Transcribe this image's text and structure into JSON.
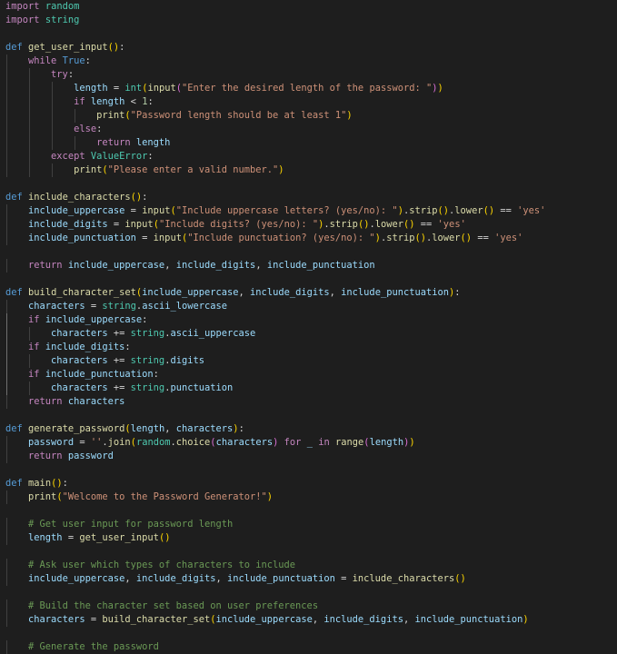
{
  "editor": {
    "language": "python",
    "theme_colors": {
      "background": "#1e1e1e",
      "keyword_control": "#c586c0",
      "keyword": "#569cd6",
      "function": "#dcdcaa",
      "variable": "#9cdcfe",
      "module": "#4ec9b0",
      "string": "#ce9178",
      "number": "#b5cea8",
      "comment": "#6a9955",
      "plain": "#d4d4d4",
      "bracket_1": "#ffd700",
      "bracket_2": "#da70d6",
      "bracket_3": "#179fff"
    },
    "lines": [
      [
        [
          "kw-ctrl",
          "import"
        ],
        [
          "plain",
          " "
        ],
        [
          "mod",
          "random"
        ]
      ],
      [
        [
          "kw-ctrl",
          "import"
        ],
        [
          "plain",
          " "
        ],
        [
          "mod",
          "string"
        ]
      ],
      [],
      [
        [
          "kw",
          "def"
        ],
        [
          "plain",
          " "
        ],
        [
          "fn",
          "get_user_input"
        ],
        [
          "p1",
          "()"
        ],
        [
          "plain",
          ":"
        ]
      ],
      [
        [
          "plain",
          "    "
        ],
        [
          "kw-ctrl",
          "while"
        ],
        [
          "plain",
          " "
        ],
        [
          "kw",
          "True"
        ],
        [
          "plain",
          ":"
        ]
      ],
      [
        [
          "plain",
          "        "
        ],
        [
          "kw-ctrl",
          "try"
        ],
        [
          "plain",
          ":"
        ]
      ],
      [
        [
          "plain",
          "            "
        ],
        [
          "var",
          "length"
        ],
        [
          "plain",
          " = "
        ],
        [
          "mod",
          "int"
        ],
        [
          "p1",
          "("
        ],
        [
          "fn",
          "input"
        ],
        [
          "p2",
          "("
        ],
        [
          "str",
          "\"Enter the desired length of the password: \""
        ],
        [
          "p2",
          ")"
        ],
        [
          "p1",
          ")"
        ]
      ],
      [
        [
          "plain",
          "            "
        ],
        [
          "kw-ctrl",
          "if"
        ],
        [
          "plain",
          " "
        ],
        [
          "var",
          "length"
        ],
        [
          "plain",
          " < "
        ],
        [
          "num",
          "1"
        ],
        [
          "plain",
          ":"
        ]
      ],
      [
        [
          "plain",
          "                "
        ],
        [
          "fn",
          "print"
        ],
        [
          "p1",
          "("
        ],
        [
          "str",
          "\"Password length should be at least 1\""
        ],
        [
          "p1",
          ")"
        ]
      ],
      [
        [
          "plain",
          "            "
        ],
        [
          "kw-ctrl",
          "else"
        ],
        [
          "plain",
          ":"
        ]
      ],
      [
        [
          "plain",
          "                "
        ],
        [
          "kw-ctrl",
          "return"
        ],
        [
          "plain",
          " "
        ],
        [
          "var",
          "length"
        ]
      ],
      [
        [
          "plain",
          "        "
        ],
        [
          "kw-ctrl",
          "except"
        ],
        [
          "plain",
          " "
        ],
        [
          "mod",
          "ValueError"
        ],
        [
          "plain",
          ":"
        ]
      ],
      [
        [
          "plain",
          "            "
        ],
        [
          "fn",
          "print"
        ],
        [
          "p1",
          "("
        ],
        [
          "str",
          "\"Please enter a valid number.\""
        ],
        [
          "p1",
          ")"
        ]
      ],
      [],
      [
        [
          "kw",
          "def"
        ],
        [
          "plain",
          " "
        ],
        [
          "fn",
          "include_characters"
        ],
        [
          "p1",
          "()"
        ],
        [
          "plain",
          ":"
        ]
      ],
      [
        [
          "plain",
          "    "
        ],
        [
          "var",
          "include_uppercase"
        ],
        [
          "plain",
          " = "
        ],
        [
          "fn",
          "input"
        ],
        [
          "p1",
          "("
        ],
        [
          "str",
          "\"Include uppercase letters? (yes/no): \""
        ],
        [
          "p1",
          ")"
        ],
        [
          "plain",
          "."
        ],
        [
          "fn",
          "strip"
        ],
        [
          "p1",
          "()"
        ],
        [
          "plain",
          "."
        ],
        [
          "fn",
          "lower"
        ],
        [
          "p1",
          "()"
        ],
        [
          "plain",
          " == "
        ],
        [
          "str",
          "'yes'"
        ]
      ],
      [
        [
          "plain",
          "    "
        ],
        [
          "var",
          "include_digits"
        ],
        [
          "plain",
          " = "
        ],
        [
          "fn",
          "input"
        ],
        [
          "p1",
          "("
        ],
        [
          "str",
          "\"Include digits? (yes/no): \""
        ],
        [
          "p1",
          ")"
        ],
        [
          "plain",
          "."
        ],
        [
          "fn",
          "strip"
        ],
        [
          "p1",
          "()"
        ],
        [
          "plain",
          "."
        ],
        [
          "fn",
          "lower"
        ],
        [
          "p1",
          "()"
        ],
        [
          "plain",
          " == "
        ],
        [
          "str",
          "'yes'"
        ]
      ],
      [
        [
          "plain",
          "    "
        ],
        [
          "var",
          "include_punctuation"
        ],
        [
          "plain",
          " = "
        ],
        [
          "fn",
          "input"
        ],
        [
          "p1",
          "("
        ],
        [
          "str",
          "\"Include punctuation? (yes/no): \""
        ],
        [
          "p1",
          ")"
        ],
        [
          "plain",
          "."
        ],
        [
          "fn",
          "strip"
        ],
        [
          "p1",
          "()"
        ],
        [
          "plain",
          "."
        ],
        [
          "fn",
          "lower"
        ],
        [
          "p1",
          "()"
        ],
        [
          "plain",
          " == "
        ],
        [
          "str",
          "'yes'"
        ]
      ],
      [],
      [
        [
          "plain",
          "    "
        ],
        [
          "kw-ctrl",
          "return"
        ],
        [
          "plain",
          " "
        ],
        [
          "var",
          "include_uppercase"
        ],
        [
          "plain",
          ", "
        ],
        [
          "var",
          "include_digits"
        ],
        [
          "plain",
          ", "
        ],
        [
          "var",
          "include_punctuation"
        ]
      ],
      [],
      [
        [
          "kw",
          "def"
        ],
        [
          "plain",
          " "
        ],
        [
          "fn",
          "build_character_set"
        ],
        [
          "p1",
          "("
        ],
        [
          "var",
          "include_uppercase"
        ],
        [
          "plain",
          ", "
        ],
        [
          "var",
          "include_digits"
        ],
        [
          "plain",
          ", "
        ],
        [
          "var",
          "include_punctuation"
        ],
        [
          "p1",
          ")"
        ],
        [
          "plain",
          ":"
        ]
      ],
      [
        [
          "plain",
          "    "
        ],
        [
          "var",
          "characters"
        ],
        [
          "plain",
          " = "
        ],
        [
          "mod",
          "string"
        ],
        [
          "plain",
          "."
        ],
        [
          "var",
          "ascii_lowercase"
        ]
      ],
      [
        [
          "plain",
          "    "
        ],
        [
          "kw-ctrl",
          "if"
        ],
        [
          "plain",
          " "
        ],
        [
          "var",
          "include_uppercase"
        ],
        [
          "plain",
          ":"
        ]
      ],
      [
        [
          "plain",
          "        "
        ],
        [
          "var",
          "characters"
        ],
        [
          "plain",
          " += "
        ],
        [
          "mod",
          "string"
        ],
        [
          "plain",
          "."
        ],
        [
          "var",
          "ascii_uppercase"
        ]
      ],
      [
        [
          "plain",
          "    "
        ],
        [
          "kw-ctrl",
          "if"
        ],
        [
          "plain",
          " "
        ],
        [
          "var",
          "include_digits"
        ],
        [
          "plain",
          ":"
        ]
      ],
      [
        [
          "plain",
          "        "
        ],
        [
          "var",
          "characters"
        ],
        [
          "plain",
          " += "
        ],
        [
          "mod",
          "string"
        ],
        [
          "plain",
          "."
        ],
        [
          "var",
          "digits"
        ]
      ],
      [
        [
          "plain",
          "    "
        ],
        [
          "kw-ctrl",
          "if"
        ],
        [
          "plain",
          " "
        ],
        [
          "var",
          "include_punctuation"
        ],
        [
          "plain",
          ":"
        ]
      ],
      [
        [
          "plain",
          "        "
        ],
        [
          "var",
          "characters"
        ],
        [
          "plain",
          " += "
        ],
        [
          "mod",
          "string"
        ],
        [
          "plain",
          "."
        ],
        [
          "var",
          "punctuation"
        ]
      ],
      [
        [
          "plain",
          "    "
        ],
        [
          "kw-ctrl",
          "return"
        ],
        [
          "plain",
          " "
        ],
        [
          "var",
          "characters"
        ]
      ],
      [],
      [
        [
          "kw",
          "def"
        ],
        [
          "plain",
          " "
        ],
        [
          "fn",
          "generate_password"
        ],
        [
          "p1",
          "("
        ],
        [
          "var",
          "length"
        ],
        [
          "plain",
          ", "
        ],
        [
          "var",
          "characters"
        ],
        [
          "p1",
          ")"
        ],
        [
          "plain",
          ":"
        ]
      ],
      [
        [
          "plain",
          "    "
        ],
        [
          "var",
          "password"
        ],
        [
          "plain",
          " = "
        ],
        [
          "str",
          "''"
        ],
        [
          "plain",
          "."
        ],
        [
          "fn",
          "join"
        ],
        [
          "p1",
          "("
        ],
        [
          "mod",
          "random"
        ],
        [
          "plain",
          "."
        ],
        [
          "fn",
          "choice"
        ],
        [
          "p2",
          "("
        ],
        [
          "var",
          "characters"
        ],
        [
          "p2",
          ")"
        ],
        [
          "plain",
          " "
        ],
        [
          "kw-ctrl",
          "for"
        ],
        [
          "plain",
          " "
        ],
        [
          "var",
          "_"
        ],
        [
          "plain",
          " "
        ],
        [
          "kw-ctrl",
          "in"
        ],
        [
          "plain",
          " "
        ],
        [
          "fn",
          "range"
        ],
        [
          "p2",
          "("
        ],
        [
          "var",
          "length"
        ],
        [
          "p2",
          ")"
        ],
        [
          "p1",
          ")"
        ]
      ],
      [
        [
          "plain",
          "    "
        ],
        [
          "kw-ctrl",
          "return"
        ],
        [
          "plain",
          " "
        ],
        [
          "var",
          "password"
        ]
      ],
      [],
      [
        [
          "kw",
          "def"
        ],
        [
          "plain",
          " "
        ],
        [
          "fn",
          "main"
        ],
        [
          "p1",
          "()"
        ],
        [
          "plain",
          ":"
        ]
      ],
      [
        [
          "plain",
          "    "
        ],
        [
          "fn",
          "print"
        ],
        [
          "p1",
          "("
        ],
        [
          "str",
          "\"Welcome to the Password Generator!\""
        ],
        [
          "p1",
          ")"
        ]
      ],
      [],
      [
        [
          "plain",
          "    "
        ],
        [
          "cmt",
          "# Get user input for password length"
        ]
      ],
      [
        [
          "plain",
          "    "
        ],
        [
          "var",
          "length"
        ],
        [
          "plain",
          " = "
        ],
        [
          "fn",
          "get_user_input"
        ],
        [
          "p1",
          "()"
        ]
      ],
      [],
      [
        [
          "plain",
          "    "
        ],
        [
          "cmt",
          "# Ask user which types of characters to include"
        ]
      ],
      [
        [
          "plain",
          "    "
        ],
        [
          "var",
          "include_uppercase"
        ],
        [
          "plain",
          ", "
        ],
        [
          "var",
          "include_digits"
        ],
        [
          "plain",
          ", "
        ],
        [
          "var",
          "include_punctuation"
        ],
        [
          "plain",
          " = "
        ],
        [
          "fn",
          "include_characters"
        ],
        [
          "p1",
          "()"
        ]
      ],
      [],
      [
        [
          "plain",
          "    "
        ],
        [
          "cmt",
          "# Build the character set based on user preferences"
        ]
      ],
      [
        [
          "plain",
          "    "
        ],
        [
          "var",
          "characters"
        ],
        [
          "plain",
          " = "
        ],
        [
          "fn",
          "build_character_set"
        ],
        [
          "p1",
          "("
        ],
        [
          "var",
          "include_uppercase"
        ],
        [
          "plain",
          ", "
        ],
        [
          "var",
          "include_digits"
        ],
        [
          "plain",
          ", "
        ],
        [
          "var",
          "include_punctuation"
        ],
        [
          "p1",
          ")"
        ]
      ],
      [],
      [
        [
          "plain",
          "    "
        ],
        [
          "cmt",
          "# Generate the password"
        ]
      ]
    ]
  }
}
